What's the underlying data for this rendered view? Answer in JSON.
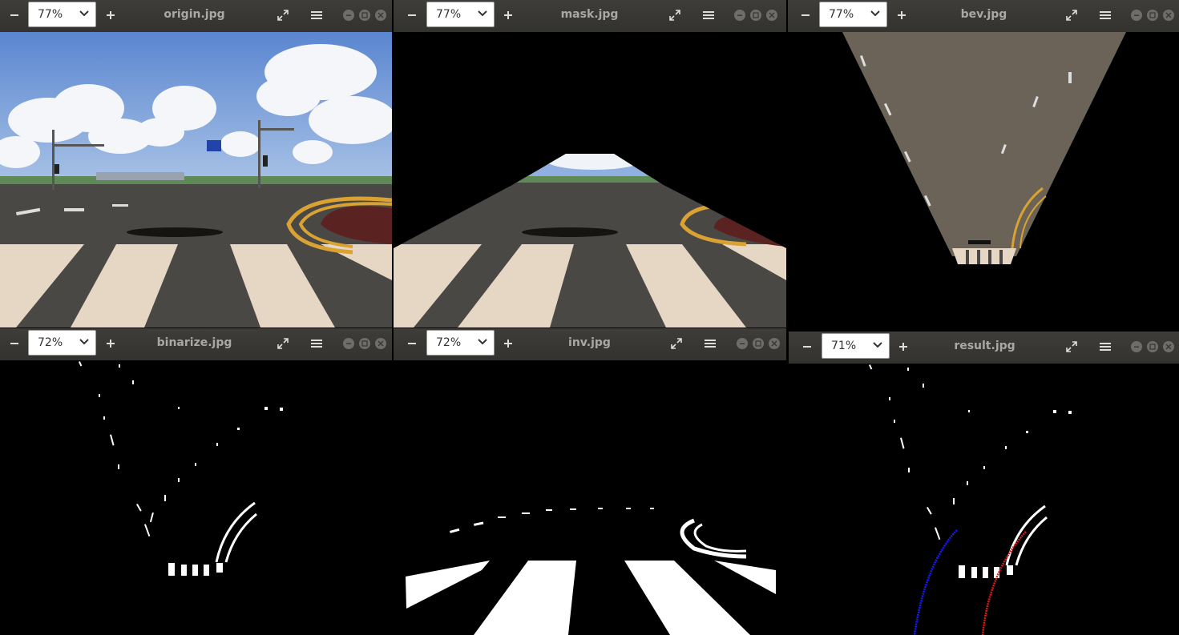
{
  "windows": [
    {
      "title": "origin.jpg",
      "zoom": "77%"
    },
    {
      "title": "mask.jpg",
      "zoom": "77%"
    },
    {
      "title": "bev.jpg",
      "zoom": "77%"
    },
    {
      "title": "binarize.jpg",
      "zoom": "72%"
    },
    {
      "title": "inv.jpg",
      "zoom": "72%"
    },
    {
      "title": "result.jpg",
      "zoom": "71%"
    }
  ],
  "icons": {
    "zoom_out": "minus-icon",
    "zoom_in": "plus-icon",
    "fit": "expand-icon",
    "menu": "hamburger-menu-icon",
    "minimize": "minimize-icon",
    "maximize": "maximize-icon",
    "close": "close-icon"
  },
  "colors": {
    "titlebar": "#3a3936",
    "sky": "#6f98d8",
    "road": "#4a4845",
    "crosswalk": "#e6d7c4",
    "lane_yellow": "#d9a233",
    "left_fit": "#1a1aff",
    "right_fit": "#e01818"
  }
}
